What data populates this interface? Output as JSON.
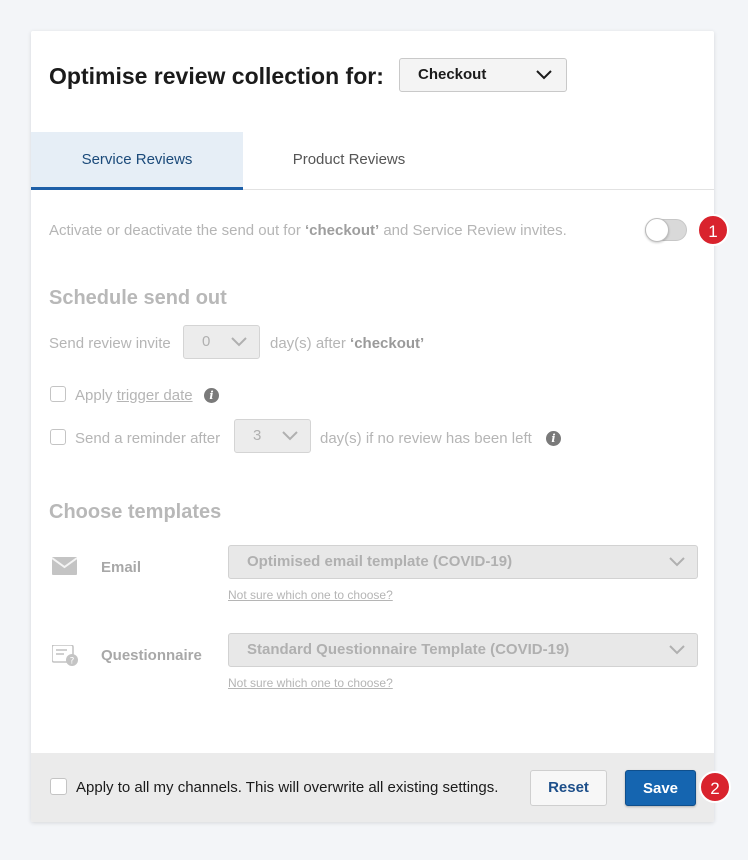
{
  "header": {
    "title": "Optimise review collection for:",
    "channel_value": "Checkout"
  },
  "tabs": [
    {
      "label": "Service Reviews",
      "active": true
    },
    {
      "label": "Product Reviews",
      "active": false
    }
  ],
  "activation": {
    "text_before": "Activate or deactivate the send out for ",
    "channel": "‘checkout’",
    "text_after": " and Service Review invites.",
    "enabled": false
  },
  "schedule": {
    "title": "Schedule send out",
    "send_invite_label": "Send review invite",
    "days_value": "0",
    "days_after_text": "day(s) after ",
    "days_after_channel": "‘checkout’",
    "apply_label": "Apply ",
    "trigger_date_link": "trigger date",
    "reminder_label": "Send a reminder after",
    "reminder_days": "3",
    "reminder_suffix": "day(s) if no review has been left"
  },
  "templates": {
    "title": "Choose templates",
    "email_label": "Email",
    "email_value": "Optimised email template (COVID-19)",
    "email_help": "Not sure which one to choose?",
    "questionnaire_label": "Questionnaire",
    "questionnaire_value": "Standard Questionnaire Template (COVID-19)",
    "questionnaire_help": "Not sure which one to choose?"
  },
  "footer": {
    "apply_all_label": "Apply to all my channels. This will overwrite all existing settings.",
    "reset_label": "Reset",
    "save_label": "Save"
  },
  "badges": [
    "1",
    "2"
  ],
  "colors": {
    "accent": "#1565b0",
    "badge": "#d9232d",
    "tab_active_bg": "#e6eef6"
  }
}
